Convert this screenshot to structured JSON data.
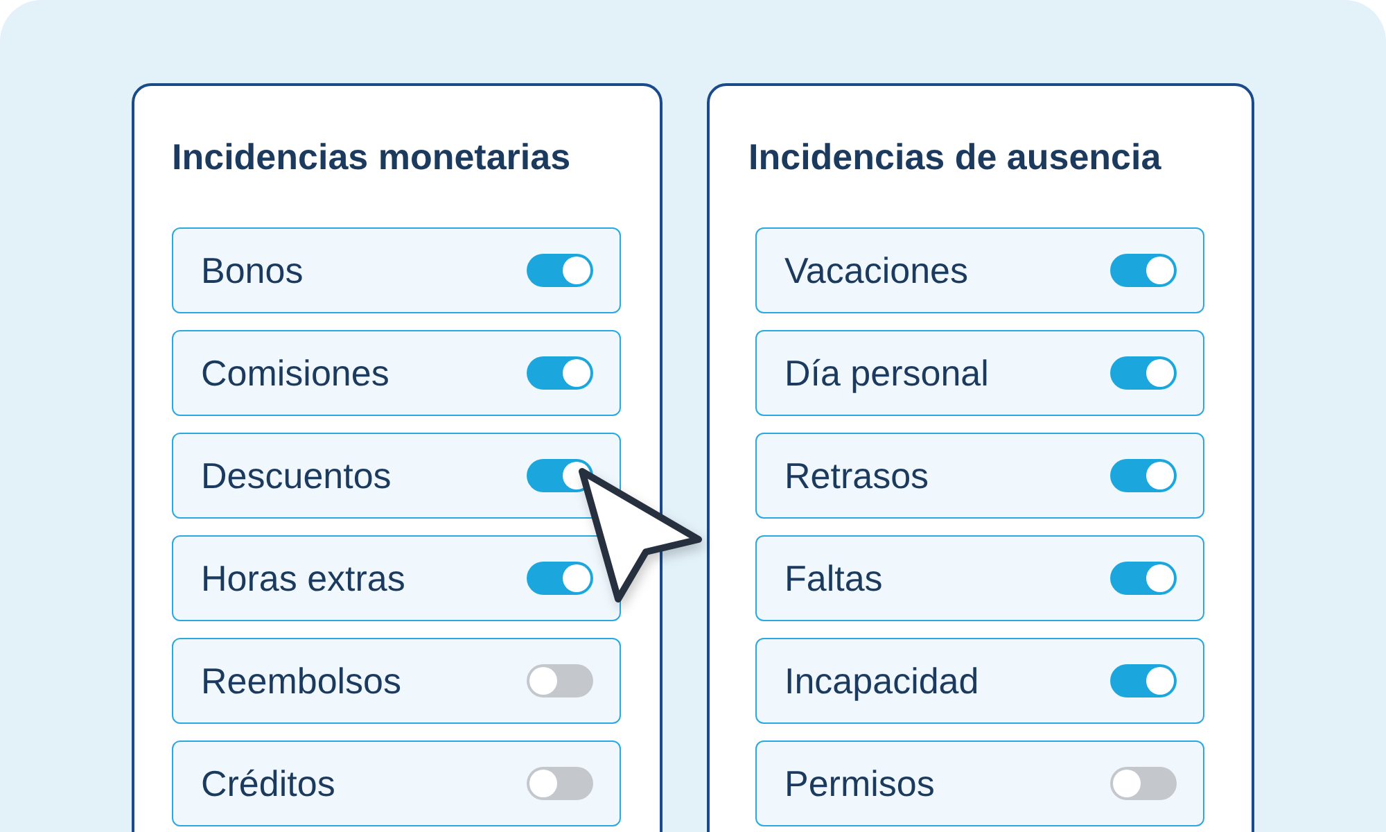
{
  "panels": [
    {
      "title": "Incidencias monetarias",
      "items": [
        {
          "label": "Bonos",
          "on": true
        },
        {
          "label": "Comisiones",
          "on": true
        },
        {
          "label": "Descuentos",
          "on": true
        },
        {
          "label": "Horas extras",
          "on": true
        },
        {
          "label": "Reembolsos",
          "on": false
        },
        {
          "label": "Créditos",
          "on": false
        }
      ]
    },
    {
      "title": "Incidencias de ausencia",
      "items": [
        {
          "label": "Vacaciones",
          "on": true
        },
        {
          "label": "Día personal",
          "on": true
        },
        {
          "label": "Retrasos",
          "on": true
        },
        {
          "label": "Faltas",
          "on": true
        },
        {
          "label": "Incapacidad",
          "on": true
        },
        {
          "label": "Permisos",
          "on": false
        }
      ]
    }
  ]
}
